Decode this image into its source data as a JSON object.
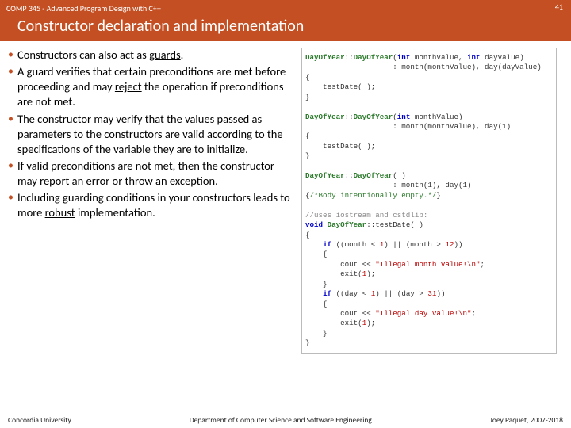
{
  "header": {
    "course": "COMP 345 - Advanced Program Design with C++",
    "page_number": "41",
    "title": "Constructor declaration and implementation"
  },
  "bullets": [
    {
      "before": "Constructors can also act as ",
      "ul": "guards",
      "after": "."
    },
    {
      "before": "A guard verifies that certain preconditions are met before proceeding and may ",
      "ul": "reject",
      "after": " the operation if preconditions are not met."
    },
    {
      "before": "The constructor may verify that the values passed as parameters to the constructors are valid according to the specifications of the variable they are to initialize.",
      "ul": "",
      "after": ""
    },
    {
      "before": "If valid preconditions are not met, then the constructor may report an error or throw an exception.",
      "ul": "",
      "after": ""
    },
    {
      "before": "Including guarding conditions in your constructors leads to more ",
      "ul": "robust",
      "after": " implementation."
    }
  ],
  "code": {
    "l01a": "DayOfYear",
    "l01b": "::",
    "l01c": "DayOfYear",
    "l01d": "(",
    "l01e": "int",
    "l01f": " monthValue, ",
    "l01g": "int",
    "l01h": " dayValue)",
    "l02": "                    : month(monthValue), day(dayValue)",
    "l03": "{",
    "l04": "    testDate( );",
    "l05": "}",
    "l06": "",
    "l07a": "DayOfYear",
    "l07b": "::",
    "l07c": "DayOfYear",
    "l07d": "(",
    "l07e": "int",
    "l07f": " monthValue)",
    "l08": "                    : month(monthValue), day(1)",
    "l09": "{",
    "l10": "    testDate( );",
    "l11": "}",
    "l12": "",
    "l13a": "DayOfYear",
    "l13b": "::",
    "l13c": "DayOfYear",
    "l13d": "( )",
    "l14": "                    : month(1), day(1)",
    "l15": "{",
    "l15c": "/*Body intentionally empty.*/",
    "l15e": "}",
    "l16": "",
    "l17": "//uses iostream and cstdlib:",
    "l18a": "void",
    "l18b": " ",
    "l18c": "DayOfYear",
    "l18d": "::testDate( )",
    "l19": "{",
    "l20a": "    ",
    "l20b": "if",
    "l20c": " ((month < ",
    "l20d": "1",
    "l20e": ") || (month > ",
    "l20f": "12",
    "l20g": "))",
    "l21": "    {",
    "l22a": "        cout << ",
    "l22b": "\"Illegal month value!\\n\"",
    "l22c": ";",
    "l23a": "        exit(",
    "l23b": "1",
    "l23c": ");",
    "l24": "    }",
    "l25a": "    ",
    "l25b": "if",
    "l25c": " ((day < ",
    "l25d": "1",
    "l25e": ") || (day > ",
    "l25f": "31",
    "l25g": "))",
    "l26": "    {",
    "l27a": "        cout << ",
    "l27b": "\"Illegal day value!\\n\"",
    "l27c": ";",
    "l28a": "        exit(",
    "l28b": "1",
    "l28c": ");",
    "l29": "    }",
    "l30": "}"
  },
  "footer": {
    "left": "Concordia University",
    "center": "Department of Computer Science and Software Engineering",
    "right": "Joey Paquet, 2007-2018"
  }
}
